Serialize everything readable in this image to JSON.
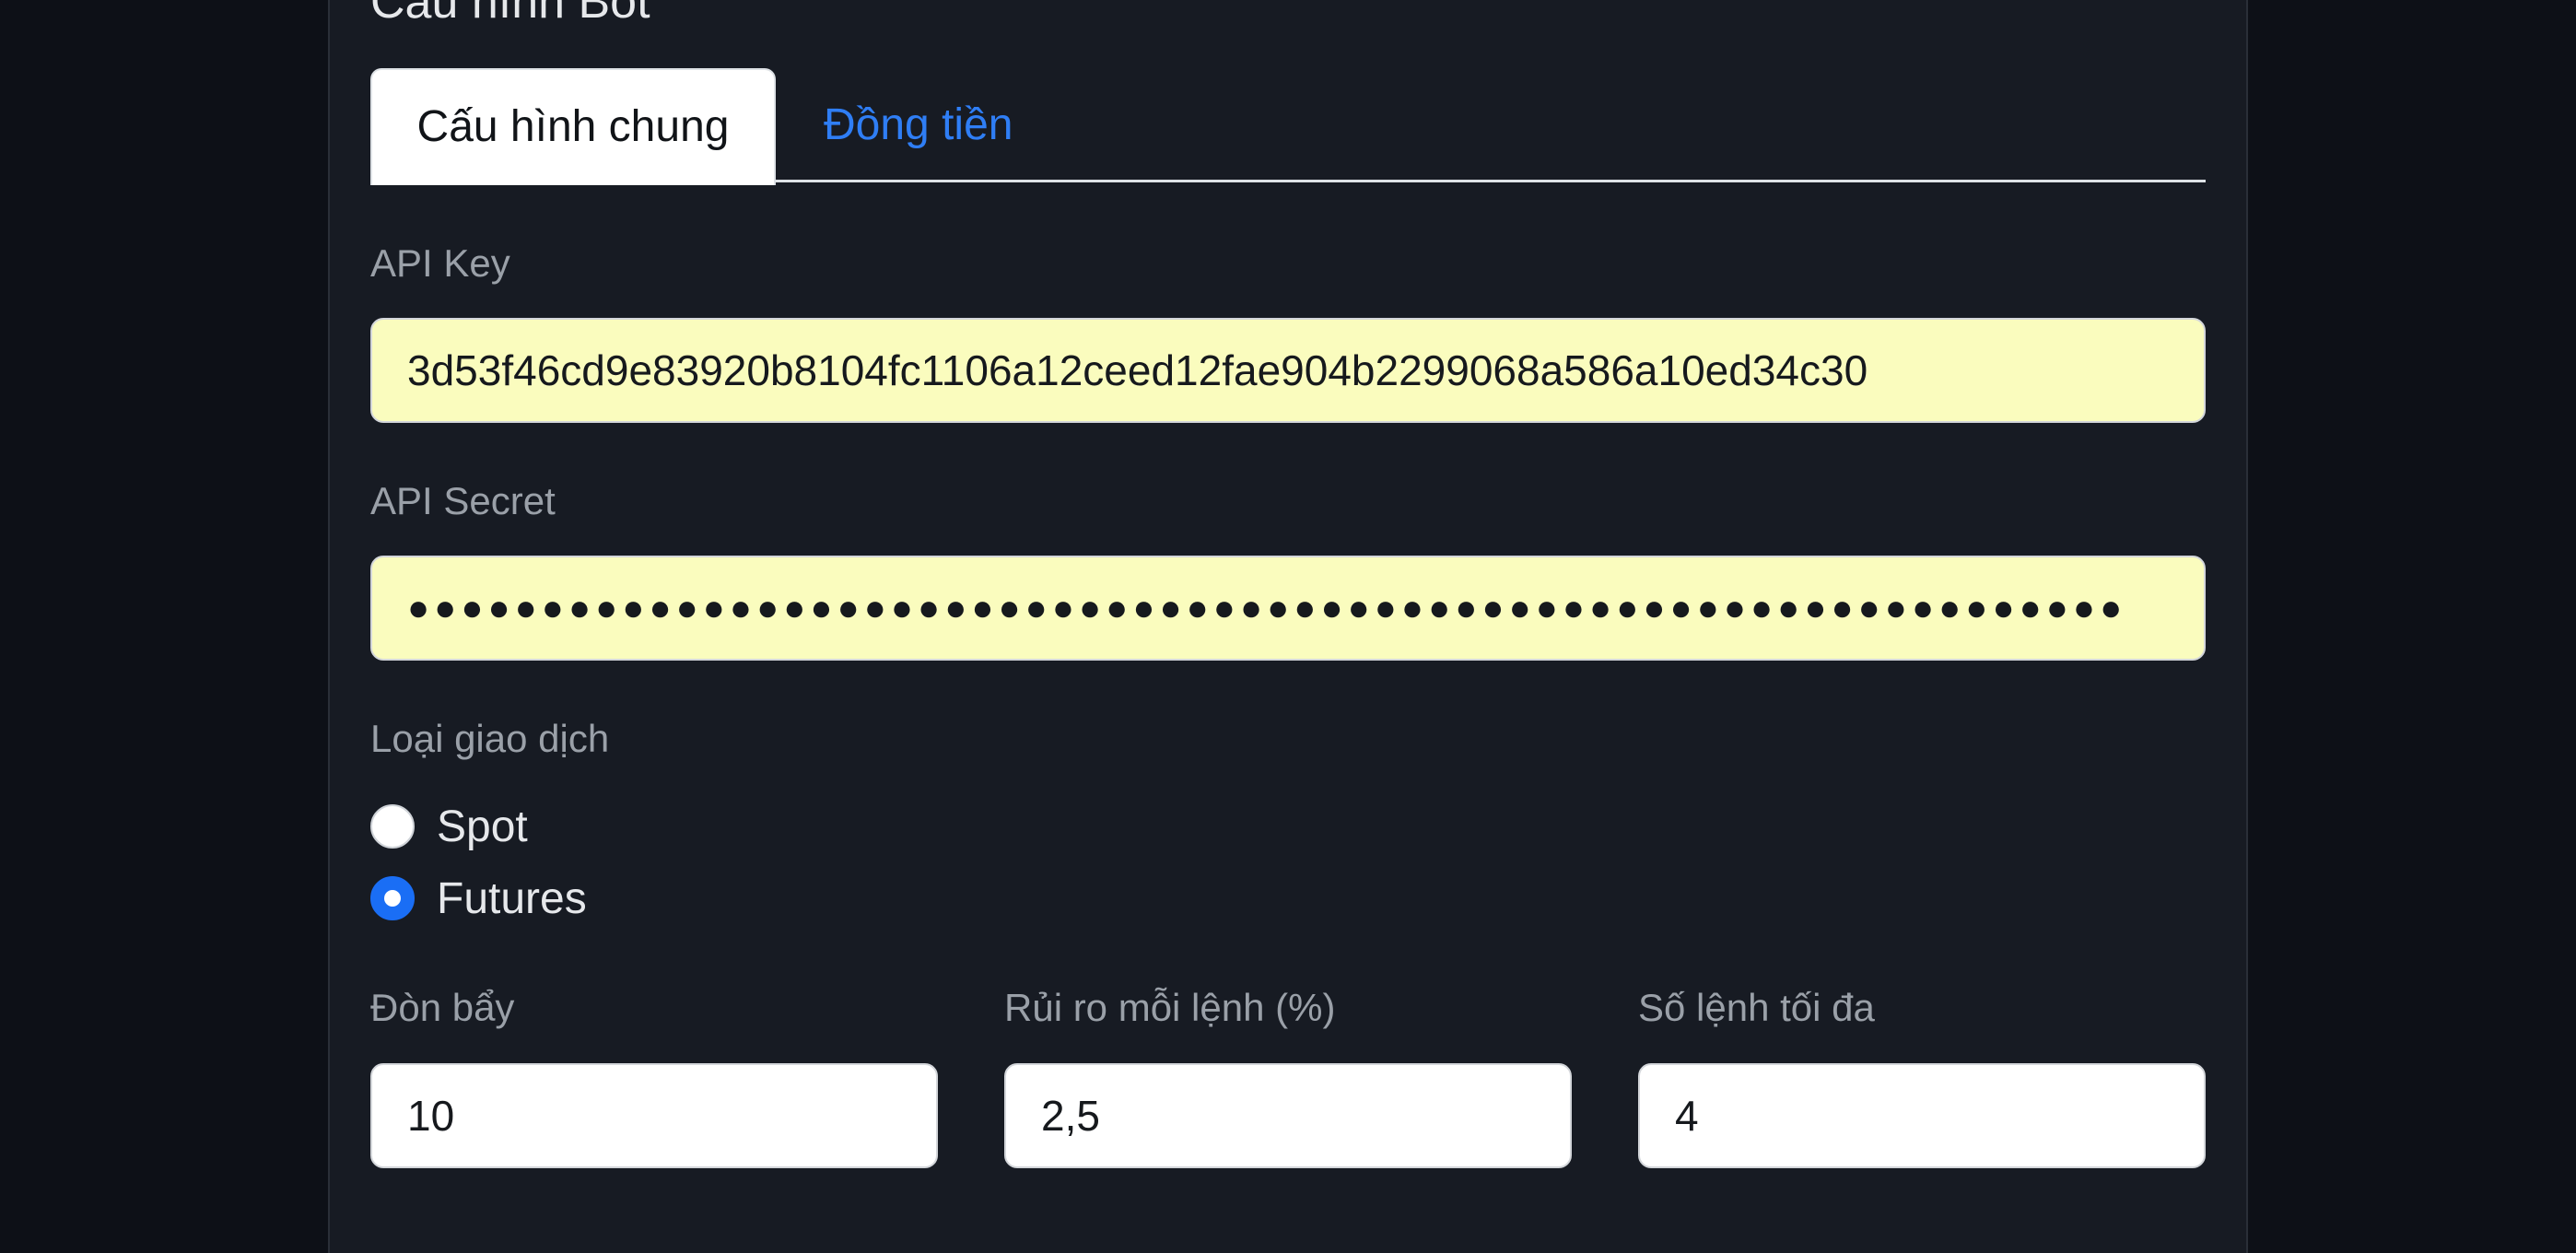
{
  "card": {
    "title": "Cấu hình Bot"
  },
  "tabs": [
    {
      "label": "Cấu hình chung",
      "active": true
    },
    {
      "label": "Đồng tiền",
      "active": false
    }
  ],
  "api_key": {
    "label": "API Key",
    "value": "3d53f46cd9e83920b8104fc1106a12ceed12fae904b2299068a586a10ed34c30"
  },
  "api_secret": {
    "label": "API Secret",
    "masked_value": "●●●●●●●●●●●●●●●●●●●●●●●●●●●●●●●●●●●●●●●●●●●●●●●●●●●●●●●●●●●●●●●●"
  },
  "trade_type": {
    "label": "Loại giao dịch",
    "options": [
      {
        "label": "Spot",
        "selected": false
      },
      {
        "label": "Futures",
        "selected": true
      }
    ]
  },
  "leverage": {
    "label": "Đòn bẩy",
    "value": "10"
  },
  "risk_per_order": {
    "label": "Rủi ro mỗi lệnh (%)",
    "value": "2,5"
  },
  "max_orders": {
    "label": "Số lệnh tối đa",
    "value": "4"
  },
  "colors": {
    "page_background": "#0d1017",
    "card_background": "#171b23",
    "accent_blue": "#1a6ef5",
    "autofill_yellow": "#fafcbe"
  }
}
